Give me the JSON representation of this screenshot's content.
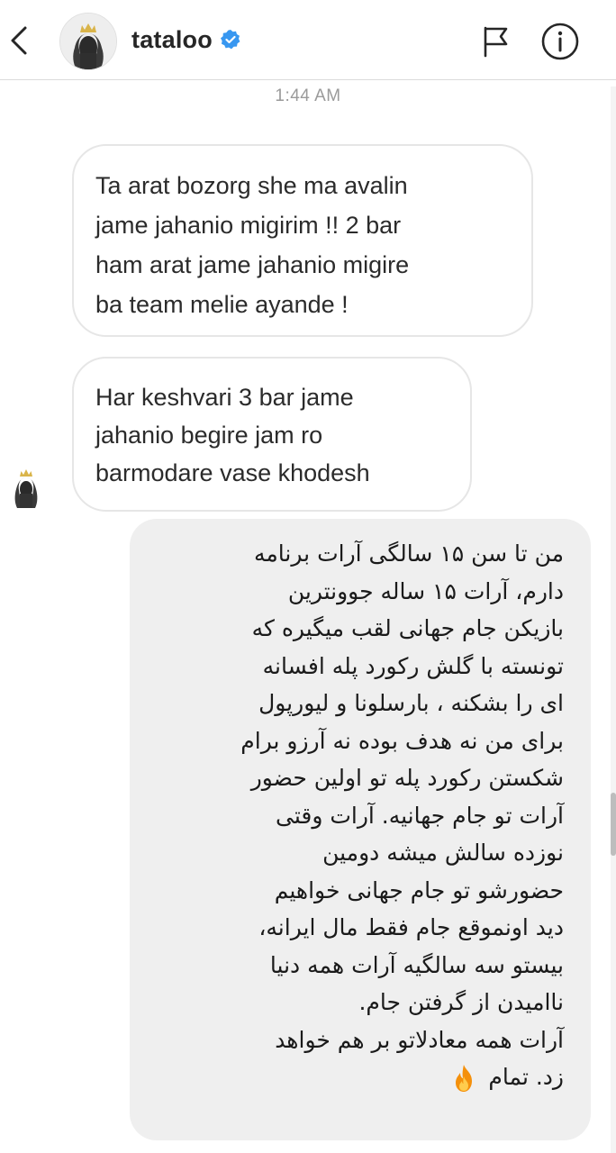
{
  "header": {
    "username": "tataloo",
    "verified": true
  },
  "thread": {
    "timestamp": "1:44 AM",
    "messages": [
      {
        "direction": "incoming",
        "lines": [
          "Ta arat bozorg she ma avalin",
          "jame jahanio migirim !! 2 bar",
          "ham  arat jame jahanio migire",
          "ba team melie ayande !"
        ]
      },
      {
        "direction": "incoming",
        "lines": [
          "Har keshvari 3 bar jame",
          "jahanio begire jam ro",
          "barmodare vase khodesh"
        ]
      },
      {
        "direction": "outgoing",
        "lines": [
          "من تا سن ۱۵ سالگی آرات برنامه",
          "دارم، آرات ۱۵ ساله جوونترین",
          "بازیکن جام جهانی لقب میگیره که",
          "تونسته با گلش  رکورد پله افسانه",
          "ای را بشکنه ، بارسلونا و لیورپول",
          "برای من نه هدف بوده نه آرزو برام",
          "شکستن رکورد پله تو اولین حضور",
          "آرات تو جام جهانیه. آرات وقتی",
          "نوزده سالش میشه دومین",
          "حضورشو تو جام جهانی خواهیم",
          "دید اونموقع جام فقط مال ایرانه،",
          "بیستو سه سالگیه آرات همه دنیا",
          "ناامیدن از گرفتن جام.",
          "آرات همه معادلاتو بر هم خواهد",
          "زد. تمام"
        ],
        "trailing_icon": "fire-emoji"
      }
    ]
  },
  "colors": {
    "verified_badge": "#3897f0",
    "incoming_border": "#e6e6e6",
    "outgoing_background": "#efefef",
    "timestamp": "#9a9a9a",
    "fire_outer": "#f4900c",
    "fire_inner": "#ffcc4d"
  },
  "icons": {
    "back": "chevron-left-icon",
    "flag": "flag-icon",
    "info": "info-circle-icon",
    "verified": "verified-badge-icon"
  }
}
